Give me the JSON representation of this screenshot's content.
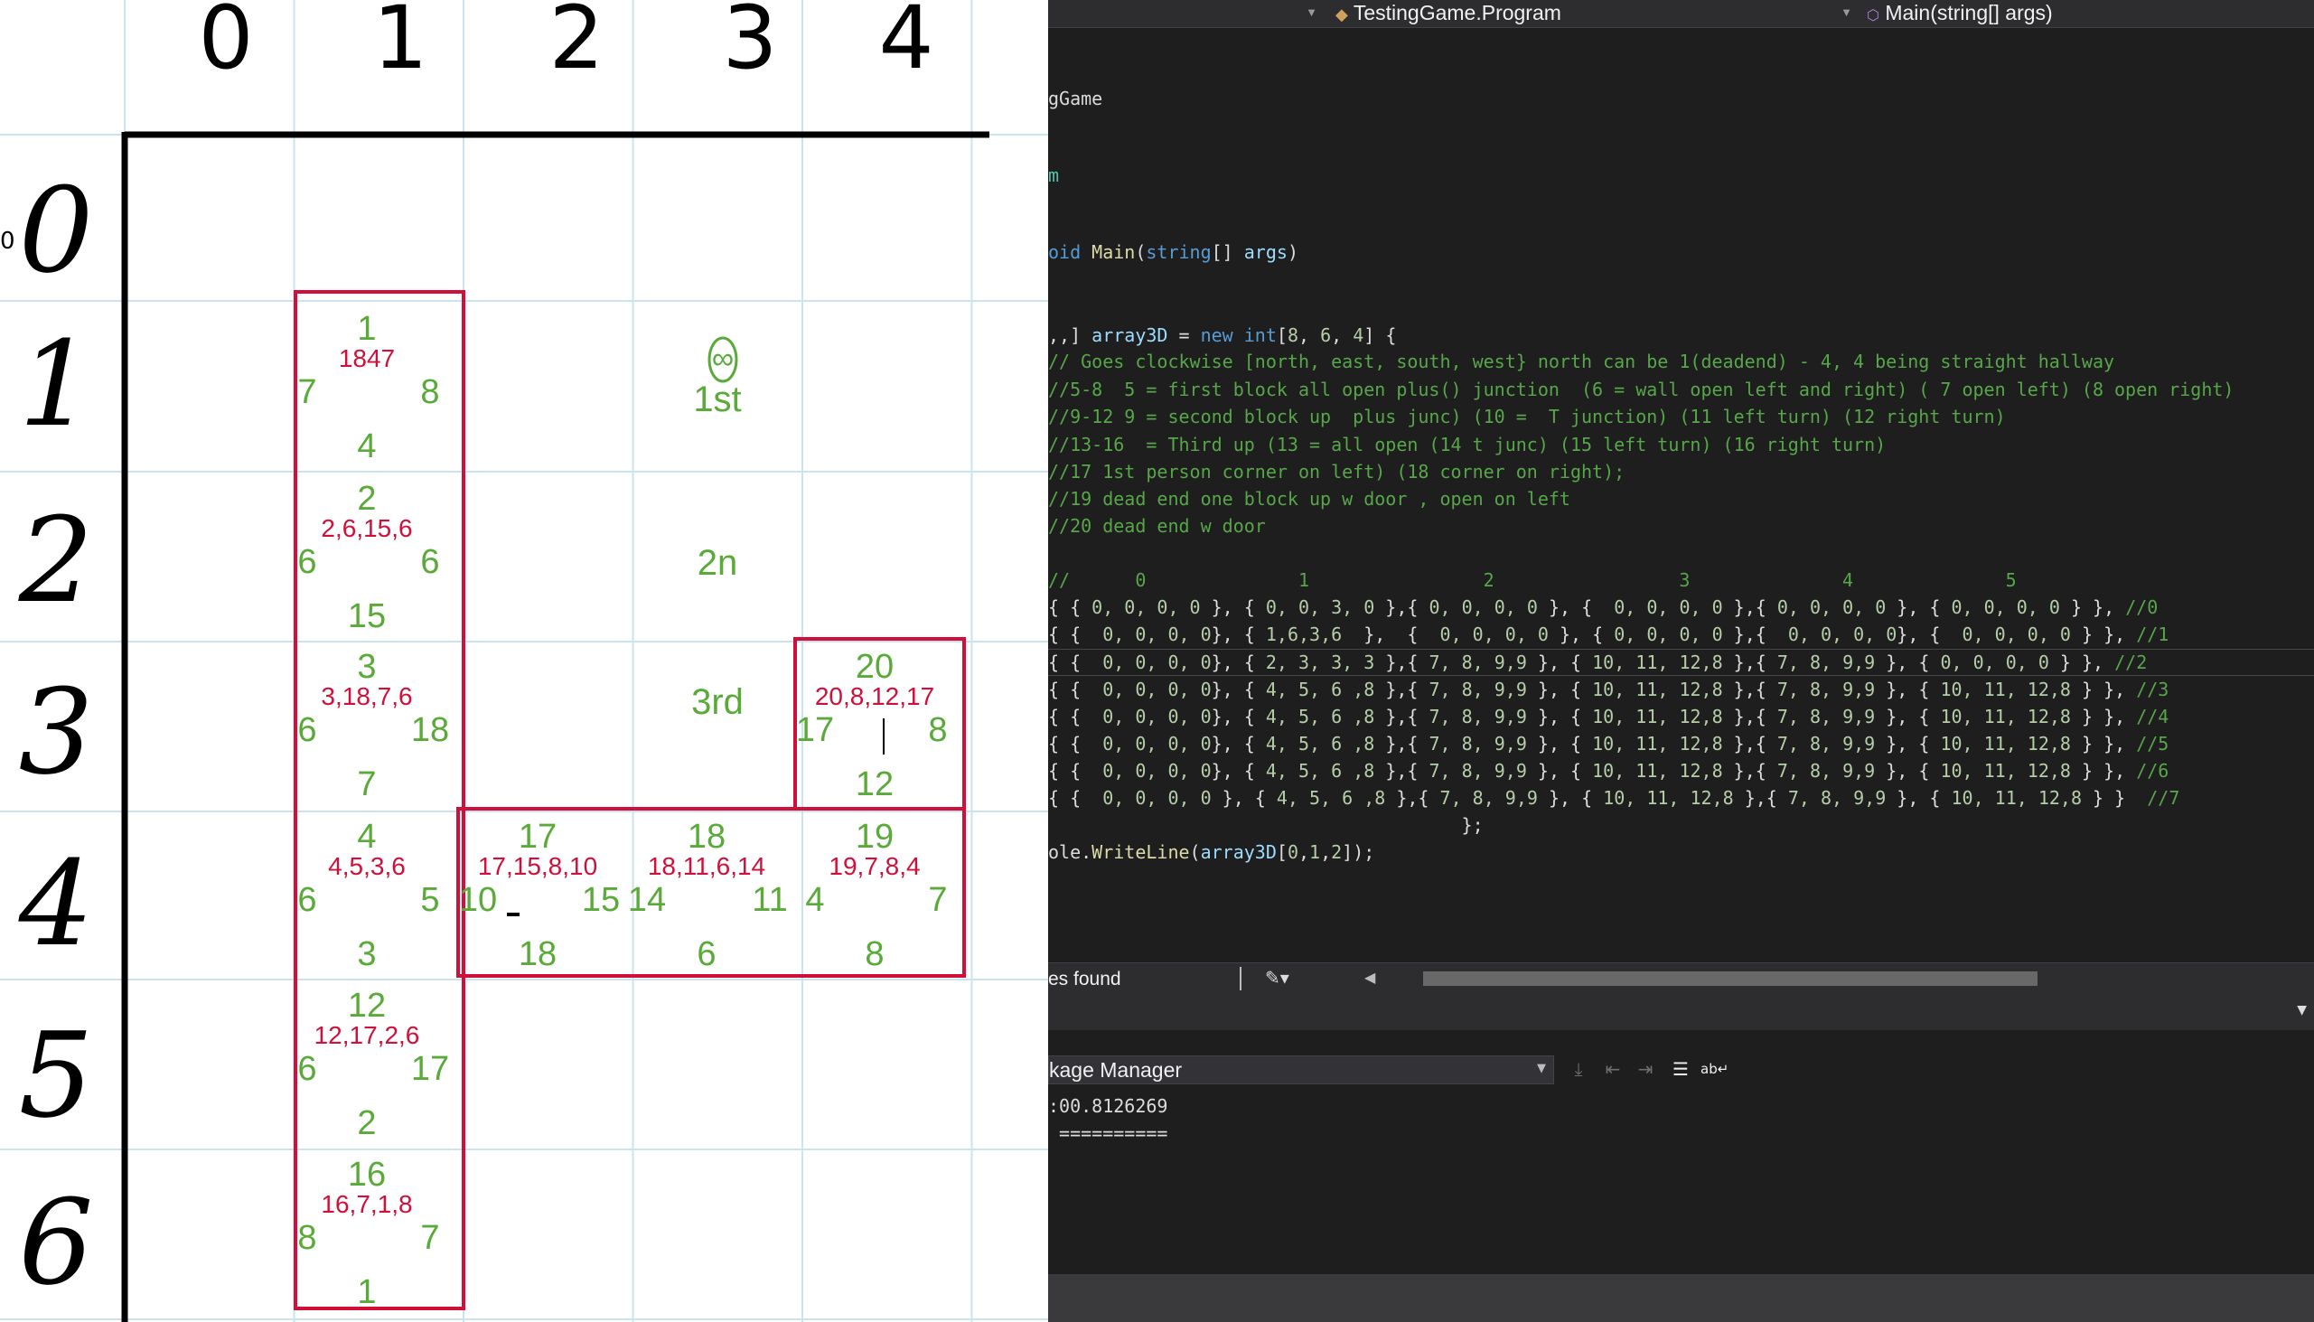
{
  "notebook": {
    "col_headers": [
      "0",
      "1",
      "2",
      "3",
      "4"
    ],
    "row_headers": [
      "0",
      "1",
      "2",
      "3",
      "4",
      "5",
      "6"
    ],
    "row_header_edge_marks": [
      "0"
    ],
    "cells": {
      "r1c1": {
        "north": "1",
        "code": "1847",
        "west": "7",
        "east": "8",
        "south": "4"
      },
      "r2c1": {
        "north": "2",
        "code": "2,6,15,6",
        "west": "6",
        "east": "6",
        "south": "15"
      },
      "r3c1": {
        "north": "3",
        "code": "3,18,7,6",
        "west": "6",
        "east": "18",
        "south": "7"
      },
      "r4c1": {
        "north": "4",
        "code": "4,5,3,6",
        "west": "6",
        "east": "5",
        "south": "3"
      },
      "r5c1": {
        "north": "12",
        "code": "12,17,2,6",
        "west": "6",
        "east": "17",
        "south": "2"
      },
      "r6c1": {
        "north": "16",
        "code": "16,7,1,8",
        "west": "8",
        "east": "7",
        "south": "1"
      },
      "r4c2": {
        "north": "17",
        "code": "17,15,8,10",
        "west": "10",
        "east": "15",
        "south": "18"
      },
      "r4c3": {
        "north": "18",
        "code": "18,11,6,14",
        "west": "14",
        "east": "11",
        "south": "6"
      },
      "r4c4": {
        "north": "19",
        "code": "19,7,8,4",
        "west": "4",
        "east": "7",
        "south": "8"
      },
      "r3c4": {
        "north": "20",
        "code": "20,8,12,17",
        "west": "17",
        "east": "8",
        "south": "12"
      }
    },
    "floor_labels": [
      {
        "id": "1st",
        "top": "∞",
        "text": "1st"
      },
      {
        "id": "2nd",
        "text": "2n"
      },
      {
        "id": "3rd",
        "text": "3rd"
      }
    ]
  },
  "ide": {
    "nav_dropdowns": {
      "type": "TestingGame.Program",
      "member": "Main(string[] args)"
    },
    "code_lines": [
      [
        {
          "c": "pl",
          "t": "gGame"
        }
      ],
      [
        {
          "c": "ty",
          "t": "m"
        }
      ],
      [
        {
          "c": "kw",
          "t": "oid "
        },
        {
          "c": "fn",
          "t": "Main"
        },
        {
          "c": "pl",
          "t": "("
        },
        {
          "c": "kw",
          "t": "string"
        },
        {
          "c": "pl",
          "t": "[] "
        },
        {
          "c": "vr",
          "t": "args"
        },
        {
          "c": "pl",
          "t": ")"
        }
      ],
      [
        {
          "c": "pl",
          "t": ",,] "
        },
        {
          "c": "vr",
          "t": "array3D"
        },
        {
          "c": "pl",
          "t": " = "
        },
        {
          "c": "kw",
          "t": "new int"
        },
        {
          "c": "pl",
          "t": "["
        },
        {
          "c": "nm",
          "t": "8"
        },
        {
          "c": "pl",
          "t": ", "
        },
        {
          "c": "nm",
          "t": "6"
        },
        {
          "c": "pl",
          "t": ", "
        },
        {
          "c": "nm",
          "t": "4"
        },
        {
          "c": "pl",
          "t": "] {"
        }
      ],
      [
        {
          "c": "cm",
          "t": "// Goes clockwise [north, east, south, west} north can be 1(deadend) - 4, 4 being straight hallway"
        }
      ],
      [
        {
          "c": "cm",
          "t": "//5-8  5 = first block all open plus() junction  (6 = wall open left and right) ( 7 open left) (8 open right)"
        }
      ],
      [
        {
          "c": "cm",
          "t": "//9-12 9 = second block up  plus junc) (10 =  T junction) (11 left turn) (12 right turn)"
        }
      ],
      [
        {
          "c": "cm",
          "t": "//13-16  = Third up (13 = all open (14 t junc) (15 left turn) (16 right turn)"
        }
      ],
      [
        {
          "c": "cm",
          "t": "//17 1st person corner on left) (18 corner on right);"
        }
      ],
      [
        {
          "c": "cm",
          "t": "//19 dead end one block up w door , open on left"
        }
      ],
      [
        {
          "c": "cm",
          "t": "//20 dead end w door"
        }
      ],
      [
        {
          "c": "pl",
          "t": ""
        }
      ],
      [
        {
          "c": "cm",
          "t": "//      0              1                2                 3              4              5"
        }
      ],
      [
        {
          "c": "pl",
          "t": "{ { "
        },
        {
          "c": "nm",
          "t": "0, 0, 0, 0"
        },
        {
          "c": "pl",
          "t": " }, { "
        },
        {
          "c": "nm",
          "t": "0, 0, 3, 0"
        },
        {
          "c": "pl",
          "t": " },{ "
        },
        {
          "c": "nm",
          "t": "0, 0, 0, 0"
        },
        {
          "c": "pl",
          "t": " }, {  "
        },
        {
          "c": "nm",
          "t": "0, 0, 0, 0"
        },
        {
          "c": "pl",
          "t": " },{ "
        },
        {
          "c": "nm",
          "t": "0, 0, 0, 0"
        },
        {
          "c": "pl",
          "t": " }, { "
        },
        {
          "c": "nm",
          "t": "0, 0, 0, 0"
        },
        {
          "c": "pl",
          "t": " } }, "
        },
        {
          "c": "cm",
          "t": "//0"
        }
      ],
      [
        {
          "c": "pl",
          "t": "{ {  "
        },
        {
          "c": "nm",
          "t": "0, 0, 0, 0"
        },
        {
          "c": "pl",
          "t": "}, { "
        },
        {
          "c": "nm",
          "t": "1,6,3,6"
        },
        {
          "c": "pl",
          "t": "  },  {  "
        },
        {
          "c": "nm",
          "t": "0, 0, 0, 0"
        },
        {
          "c": "pl",
          "t": " }, { "
        },
        {
          "c": "nm",
          "t": "0, 0, 0, 0"
        },
        {
          "c": "pl",
          "t": " },{  "
        },
        {
          "c": "nm",
          "t": "0, 0, 0, 0"
        },
        {
          "c": "pl",
          "t": "}, {  "
        },
        {
          "c": "nm",
          "t": "0, 0, 0, 0"
        },
        {
          "c": "pl",
          "t": " } }, "
        },
        {
          "c": "cm",
          "t": "//1"
        }
      ],
      [
        {
          "c": "pl",
          "t": "{ {  "
        },
        {
          "c": "nm",
          "t": "0, 0, 0, 0"
        },
        {
          "c": "pl",
          "t": "}, { "
        },
        {
          "c": "nm",
          "t": "2, 3, 3, 3"
        },
        {
          "c": "pl",
          "t": " },{ "
        },
        {
          "c": "nm",
          "t": "7, 8, 9,9"
        },
        {
          "c": "pl",
          "t": " }, { "
        },
        {
          "c": "nm",
          "t": "10, 11, 12,8"
        },
        {
          "c": "pl",
          "t": " },{ "
        },
        {
          "c": "nm",
          "t": "7, 8, 9,9"
        },
        {
          "c": "pl",
          "t": " }, { "
        },
        {
          "c": "nm",
          "t": "0, 0, 0, 0"
        },
        {
          "c": "pl",
          "t": " } }, "
        },
        {
          "c": "cm",
          "t": "//2"
        }
      ],
      [
        {
          "c": "pl",
          "t": "{ {  "
        },
        {
          "c": "nm",
          "t": "0, 0, 0, 0"
        },
        {
          "c": "pl",
          "t": "}, { "
        },
        {
          "c": "nm",
          "t": "4, 5, 6 ,8"
        },
        {
          "c": "pl",
          "t": " },{ "
        },
        {
          "c": "nm",
          "t": "7, 8, 9,9"
        },
        {
          "c": "pl",
          "t": " }, { "
        },
        {
          "c": "nm",
          "t": "10, 11, 12,8"
        },
        {
          "c": "pl",
          "t": " },{ "
        },
        {
          "c": "nm",
          "t": "7, 8, 9,9"
        },
        {
          "c": "pl",
          "t": " }, { "
        },
        {
          "c": "nm",
          "t": "10, 11, 12,8"
        },
        {
          "c": "pl",
          "t": " } }, "
        },
        {
          "c": "cm",
          "t": "//3"
        }
      ],
      [
        {
          "c": "pl",
          "t": "{ {  "
        },
        {
          "c": "nm",
          "t": "0, 0, 0, 0"
        },
        {
          "c": "pl",
          "t": "}, { "
        },
        {
          "c": "nm",
          "t": "4, 5, 6 ,8"
        },
        {
          "c": "pl",
          "t": " },{ "
        },
        {
          "c": "nm",
          "t": "7, 8, 9,9"
        },
        {
          "c": "pl",
          "t": " }, { "
        },
        {
          "c": "nm",
          "t": "10, 11, 12,8"
        },
        {
          "c": "pl",
          "t": " },{ "
        },
        {
          "c": "nm",
          "t": "7, 8, 9,9"
        },
        {
          "c": "pl",
          "t": " }, { "
        },
        {
          "c": "nm",
          "t": "10, 11, 12,8"
        },
        {
          "c": "pl",
          "t": " } }, "
        },
        {
          "c": "cm",
          "t": "//4"
        }
      ],
      [
        {
          "c": "pl",
          "t": "{ {  "
        },
        {
          "c": "nm",
          "t": "0, 0, 0, 0"
        },
        {
          "c": "pl",
          "t": "}, { "
        },
        {
          "c": "nm",
          "t": "4, 5, 6 ,8"
        },
        {
          "c": "pl",
          "t": " },{ "
        },
        {
          "c": "nm",
          "t": "7, 8, 9,9"
        },
        {
          "c": "pl",
          "t": " }, { "
        },
        {
          "c": "nm",
          "t": "10, 11, 12,8"
        },
        {
          "c": "pl",
          "t": " },{ "
        },
        {
          "c": "nm",
          "t": "7, 8, 9,9"
        },
        {
          "c": "pl",
          "t": " }, { "
        },
        {
          "c": "nm",
          "t": "10, 11, 12,8"
        },
        {
          "c": "pl",
          "t": " } }, "
        },
        {
          "c": "cm",
          "t": "//5"
        }
      ],
      [
        {
          "c": "pl",
          "t": "{ {  "
        },
        {
          "c": "nm",
          "t": "0, 0, 0, 0"
        },
        {
          "c": "pl",
          "t": "}, { "
        },
        {
          "c": "nm",
          "t": "4, 5, 6 ,8"
        },
        {
          "c": "pl",
          "t": " },{ "
        },
        {
          "c": "nm",
          "t": "7, 8, 9,9"
        },
        {
          "c": "pl",
          "t": " }, { "
        },
        {
          "c": "nm",
          "t": "10, 11, 12,8"
        },
        {
          "c": "pl",
          "t": " },{ "
        },
        {
          "c": "nm",
          "t": "7, 8, 9,9"
        },
        {
          "c": "pl",
          "t": " }, { "
        },
        {
          "c": "nm",
          "t": "10, 11, 12,8"
        },
        {
          "c": "pl",
          "t": " } }, "
        },
        {
          "c": "cm",
          "t": "//6"
        }
      ],
      [
        {
          "c": "pl",
          "t": "{ {  "
        },
        {
          "c": "nm",
          "t": "0, 0, 0, 0"
        },
        {
          "c": "pl",
          "t": " }, { "
        },
        {
          "c": "nm",
          "t": "4, 5, 6 ,8"
        },
        {
          "c": "pl",
          "t": " },{ "
        },
        {
          "c": "nm",
          "t": "7, 8, 9,9"
        },
        {
          "c": "pl",
          "t": " }, { "
        },
        {
          "c": "nm",
          "t": "10, 11, 12,8"
        },
        {
          "c": "pl",
          "t": " },{ "
        },
        {
          "c": "nm",
          "t": "7, 8, 9,9"
        },
        {
          "c": "pl",
          "t": " }, { "
        },
        {
          "c": "nm",
          "t": "10, 11, 12,8"
        },
        {
          "c": "pl",
          "t": " } }  "
        },
        {
          "c": "cm",
          "t": "//7"
        }
      ],
      [
        {
          "c": "pl",
          "t": "                                      };"
        }
      ],
      [
        {
          "c": "pl",
          "t": "ole."
        },
        {
          "c": "fn",
          "t": "WriteLine"
        },
        {
          "c": "pl",
          "t": "("
        },
        {
          "c": "vr",
          "t": "array3D"
        },
        {
          "c": "pl",
          "t": "["
        },
        {
          "c": "nm",
          "t": "0"
        },
        {
          "c": "pl",
          "t": ","
        },
        {
          "c": "nm",
          "t": "1"
        },
        {
          "c": "pl",
          "t": ","
        },
        {
          "c": "nm",
          "t": "2"
        },
        {
          "c": "pl",
          "t": "]);"
        }
      ]
    ],
    "issues_text": "es found",
    "output_source": "kage Manager",
    "output_lines": [
      ":00.8126269",
      " =========="
    ]
  },
  "colors": {
    "notebook_grid": "#c9e3ef",
    "notebook_ink": "#000000",
    "pen_red": "#d0103a",
    "pen_green": "#5aaa3a",
    "ide_bg": "#1e1e1e"
  }
}
